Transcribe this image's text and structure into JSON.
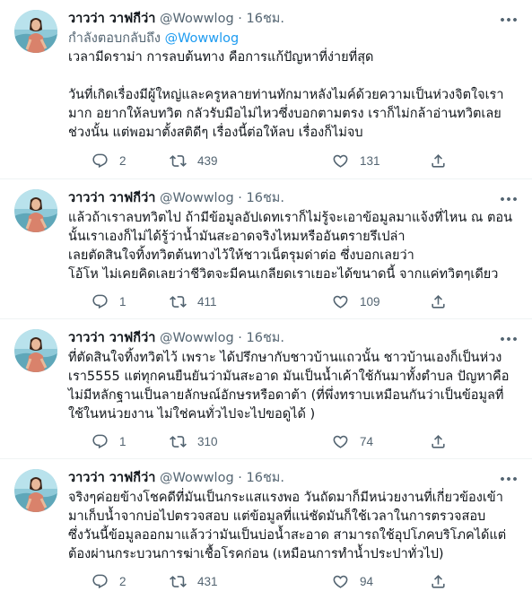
{
  "tweets": [
    {
      "display_name": "วาวว่า วาฟกีว่า",
      "handle": "@Wowwlog",
      "dot": "·",
      "time": "16ชม.",
      "reply_prefix": "กำลังตอบกลับถึง",
      "reply_mention": "@Wowwlog",
      "text": "เวลามีดราม่า การลบต้นทาง คือการแก้ปัญหาที่ง่ายที่สุด\n\nวันที่เกิดเรื่องมีผู้ใหญ่และครูหลายท่านทักมาหลังไมค์ด้วยความเป็นห่วงจิตใจเรามาก อยากให้ลบทวิต กลัวรับมือไม่ไหวซึ่งบอกตามตรง เราก็ไม่กล้าอ่านทวิตเลยช่วงนั้น แต่พอมาตั้งสติดีๆ เรื่องนี้ต่อให้ลบ เรื่องก็ไม่จบ",
      "replies": "2",
      "retweets": "439",
      "likes": "131"
    },
    {
      "display_name": "วาวว่า วาฟกีว่า",
      "handle": "@Wowwlog",
      "dot": "·",
      "time": "16ชม.",
      "text": "แล้วถ้าเราลบทวิตไป ถ้ามีข้อมูลอัปเดทเราก็ไม่รู้จะเอาข้อมูลมาแจ้งที่ไหน ณ ตอนนั้นเราเองก็ไม่ได้รู้ว่าน้ำมันสะอาดจริงไหมหรืออันตรายรึเปล่า\nเลยตัดสินใจทิ้งทวิตต้นทางไว้ให้ชาวเน็ตรุมด่าต่อ ซึ่งบอกเลยว่า\nโอ้โห ไม่เคยคิดเลยว่าชีวิตจะมีคนเกลียดเราเยอะได้ขนาดนี้ จากแค่ทวิตๆเดียว",
      "replies": "1",
      "retweets": "411",
      "likes": "109"
    },
    {
      "display_name": "วาวว่า วาฟกีว่า",
      "handle": "@Wowwlog",
      "dot": "·",
      "time": "16ชม.",
      "text": "ที่ตัดสินใจทิ้งทวิตไว้ เพราะ ได้ปรึกษากับชาวบ้านแถวนั้น ชาวบ้านเองก็เป็นห่วงเรา5555 แต่ทุกคนยืนยันว่ามันสะอาด มันเป็นน้ำเค้าใช้กันมาทั้งตำบล ปัญหาคือไม่มีหลักฐานเป็นลายลักษณ์อักษรหรือดาต้า (ที่พึ่งทราบเหมือนกันว่าเป็นข้อมูลที่ใช้ในหน่วยงาน ไม่ใช่คนทั่วไปจะไปขอดูได้ )",
      "replies": "1",
      "retweets": "310",
      "likes": "74"
    },
    {
      "display_name": "วาวว่า วาฟกีว่า",
      "handle": "@Wowwlog",
      "dot": "·",
      "time": "16ชม.",
      "text": "จริงๆค่อยข้างโชคดีที่มันเป็นกระแสแรงพอ วันถัดมาก็มีหน่วยงานที่เกี่ยวข้องเข้ามาเก็บน้ำจากบ่อไปตรวจสอบ แต่ข้อมูลที่แน่ชัดมันก็ใช้เวลาในการตรวจสอบ\nซึ่งวันนี้ข้อมูลออกมาแล้วว่ามันเป็นบ่อน้ำสะอาด สามารถใช้อุปโภคบริโภคได้แต่ต้องผ่านกระบวนการฆ่าเชื้อโรคก่อน (เหมือนการทำน้ำประปาทั่วไป)",
      "replies": "2",
      "retweets": "431",
      "likes": "94"
    }
  ],
  "icons": {
    "reply": "reply-icon",
    "retweet": "retweet-icon",
    "like": "heart-icon",
    "share": "share-icon",
    "more": "more-icon"
  },
  "colors": {
    "text": "#0f1419",
    "secondary": "#536471",
    "mention": "#1d9bf0",
    "divider": "#eff3f4"
  }
}
